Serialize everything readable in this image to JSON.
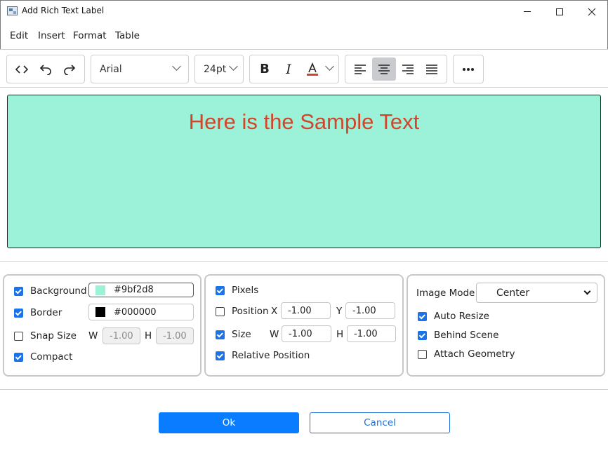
{
  "window": {
    "title": "Add Rich Text Label"
  },
  "menu": [
    "Edit",
    "Insert",
    "Format",
    "Table"
  ],
  "toolbar": {
    "font_family": "Arial",
    "font_size": "24pt",
    "text_color": "#d2452c",
    "active_alignment": "center"
  },
  "editor": {
    "sample_text": "Here is the Sample Text",
    "background": "#9bf2d8",
    "text_color": "#d2452c"
  },
  "panel_left": {
    "background": {
      "label": "Background",
      "checked": true,
      "value": "#9bf2d8",
      "swatch": "#9bf2d8"
    },
    "border": {
      "label": "Border",
      "checked": true,
      "value": "#000000",
      "swatch": "#000000"
    },
    "snap_size": {
      "label": "Snap Size",
      "checked": false,
      "w_label": "W",
      "w_value": "-1.00",
      "h_label": "H",
      "h_value": "-1.00"
    },
    "compact": {
      "label": "Compact",
      "checked": true
    }
  },
  "panel_middle": {
    "pixels": {
      "label": "Pixels",
      "checked": true
    },
    "position": {
      "label": "Position",
      "checked": false,
      "x_label": "X",
      "x_value": "-1.00",
      "y_label": "Y",
      "y_value": "-1.00"
    },
    "size": {
      "label": "Size",
      "checked": true,
      "w_label": "W",
      "w_value": "-1.00",
      "h_label": "H",
      "h_value": "-1.00"
    },
    "relative_position": {
      "label": "Relative Position",
      "checked": true
    }
  },
  "panel_right": {
    "image_mode_label": "Image Mode",
    "image_mode_value": "Center",
    "auto_resize": {
      "label": "Auto Resize",
      "checked": true
    },
    "behind_scene": {
      "label": "Behind Scene",
      "checked": true
    },
    "attach_geometry": {
      "label": "Attach Geometry",
      "checked": false
    }
  },
  "buttons": {
    "ok": "Ok",
    "cancel": "Cancel"
  },
  "colors": {
    "accent": "#0a7cff",
    "checkbox": "#1a73e8"
  }
}
